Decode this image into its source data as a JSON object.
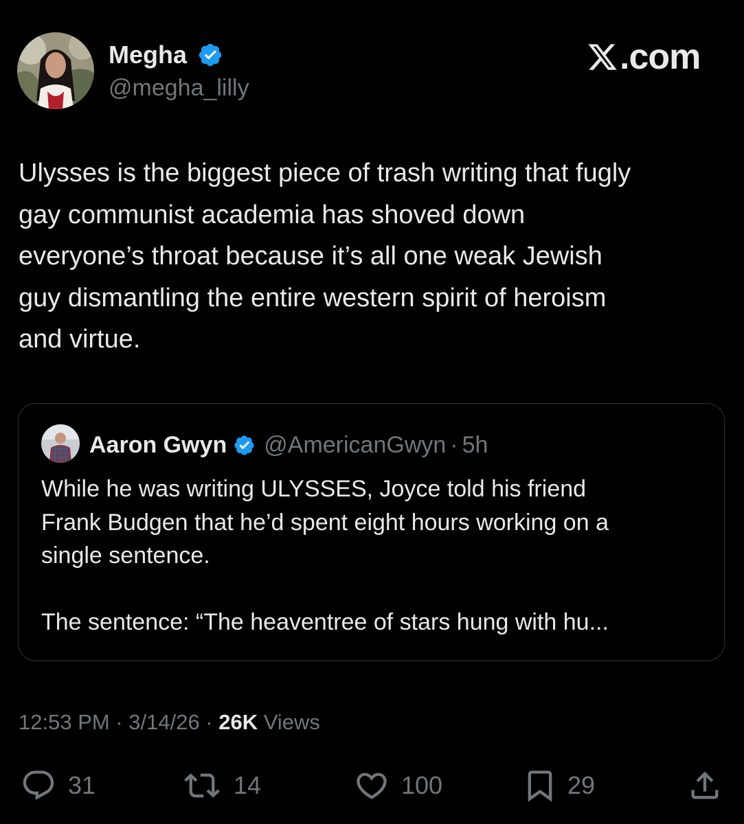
{
  "author": {
    "display_name": "Megha",
    "handle": "@megha_lilly",
    "verified": true
  },
  "brand": {
    "label": ".com",
    "icon": "x-logo-icon"
  },
  "tweet": {
    "text": "Ulysses is the biggest piece of trash writing that fugly\ngay communist academia has shoved down\neveryone’s throat because it’s all one weak Jewish\nguy dismantling the entire western spirit of heroism\nand virtue."
  },
  "quote": {
    "display_name": "Aaron Gwyn",
    "handle": "@AmericanGwyn",
    "separator": "·",
    "time": "5h",
    "verified": true,
    "text": "While he was writing ULYSSES, Joyce told his friend\nFrank Budgen that he’d spent eight hours working on a\nsingle sentence.\n\nThe sentence: “The heaventree of stars hung with hu..."
  },
  "meta": {
    "time": "12:53 PM",
    "separator": "·",
    "date": "3/14/26",
    "views_count": "26K",
    "views_label": "Views"
  },
  "actions": {
    "reply": {
      "icon": "reply-icon",
      "count": "31"
    },
    "retweet": {
      "icon": "retweet-icon",
      "count": "14"
    },
    "like": {
      "icon": "heart-icon",
      "count": "100"
    },
    "bookmark": {
      "icon": "bookmark-icon",
      "count": "29"
    },
    "share": {
      "icon": "share-icon"
    }
  },
  "colors": {
    "background": "#000000",
    "primary_text": "#e7e9ea",
    "secondary_text": "#71767b",
    "verified_blue": "#1d9bf0",
    "border": "#2f3336"
  }
}
